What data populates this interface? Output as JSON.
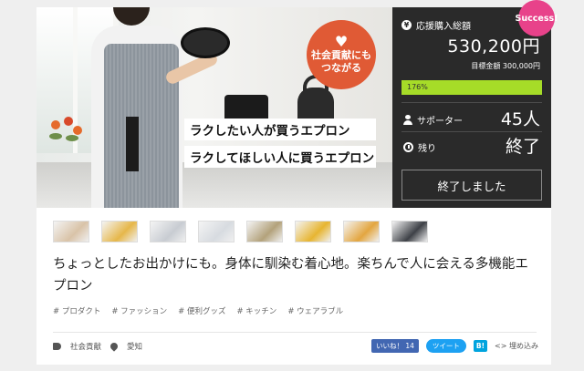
{
  "hero": {
    "badge_text": "社会貢献にも\nつながる",
    "caption_line1": "ラクしたい人が買うエプロン",
    "caption_line2": "ラクしてほしい人に買うエプロン"
  },
  "panel": {
    "success_label": "Success!",
    "total_label": "応援購入総額",
    "amount": "530,200円",
    "goal": "目標金額 300,000円",
    "progress_percent": 176,
    "progress_label": "176%",
    "supporters_label": "サポーター",
    "supporters_value": "45人",
    "remaining_label": "残り",
    "remaining_value": "終了",
    "ended_button": "終了しました"
  },
  "thumbnails": [
    {
      "color": "#d9c3a8"
    },
    {
      "color": "#e6b74a"
    },
    {
      "color": "#c8ccd2"
    },
    {
      "color": "#d7dbe0"
    },
    {
      "color": "#b3a27b"
    },
    {
      "color": "#e7b531"
    },
    {
      "color": "#e3a640"
    },
    {
      "color": "#3e4147"
    }
  ],
  "description": "ちょっとしたお出かけにも。身体に馴染む着心地。楽ちんで人に会える多機能エプロン",
  "tags": [
    "# プロダクト",
    "# ファッション",
    "# 便利グッズ",
    "# キッチン",
    "# ウェアラブル"
  ],
  "meta": {
    "category": "社会貢献",
    "location": "愛知"
  },
  "social": {
    "like": "いいね！ 14",
    "tweet": "ツイート",
    "hatena": "B!",
    "embed": "埋め込み"
  }
}
